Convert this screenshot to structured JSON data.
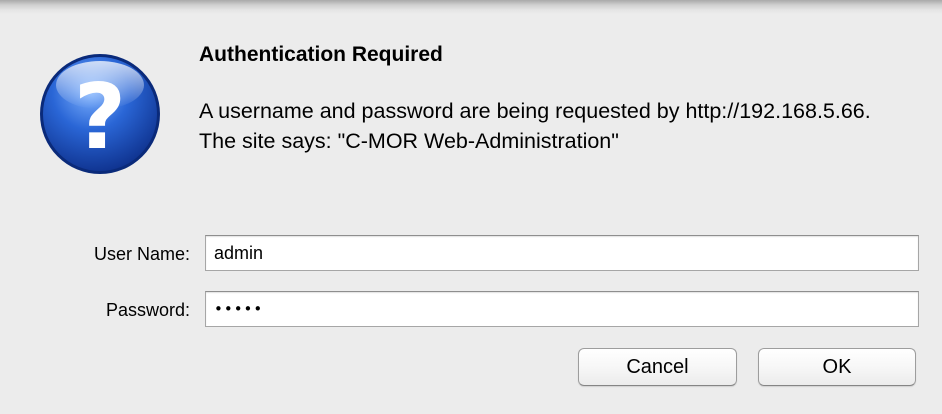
{
  "dialog": {
    "title": "Authentication Required",
    "message": "A username and password are being requested by http://192.168.5.66. The site says: \"C-MOR Web-Administration\"",
    "icon": "question-mark-icon"
  },
  "form": {
    "username_label": "User Name:",
    "username_value": "admin",
    "password_label": "Password:",
    "password_value": "•••••"
  },
  "buttons": {
    "cancel_label": "Cancel",
    "ok_label": "OK"
  },
  "colors": {
    "icon_blue": "#2a66d6",
    "background": "#ececec"
  }
}
